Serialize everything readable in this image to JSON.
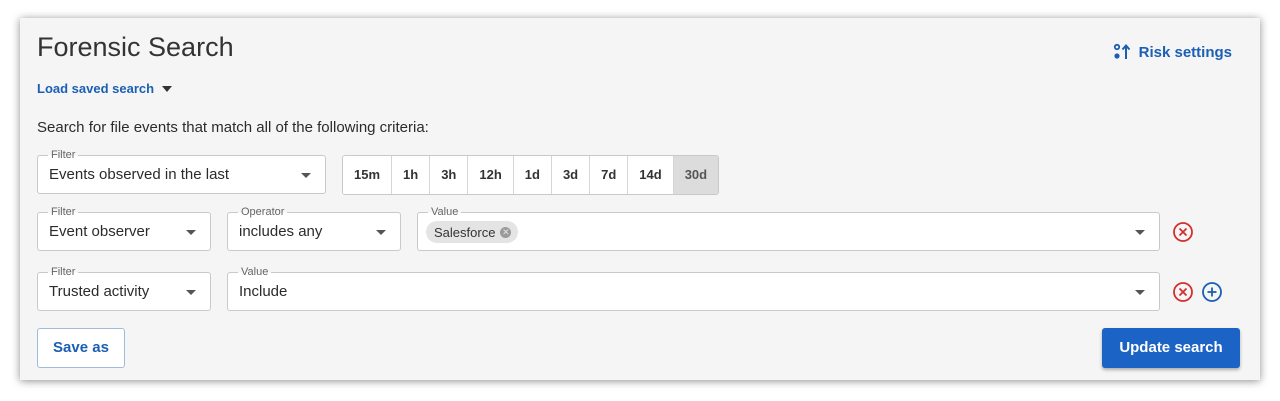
{
  "header": {
    "title": "Forensic Search",
    "risk_settings_label": "Risk settings",
    "load_saved_label": "Load saved search"
  },
  "description": "Search for file events that match all of the following criteria:",
  "row1": {
    "filter_label": "Filter",
    "filter_value": "Events observed in the last",
    "ranges": [
      "15m",
      "1h",
      "3h",
      "12h",
      "1d",
      "3d",
      "7d",
      "14d",
      "30d"
    ],
    "selected_range": "30d"
  },
  "row2": {
    "filter_label": "Filter",
    "filter_value": "Event observer",
    "operator_label": "Operator",
    "operator_value": "includes any",
    "value_label": "Value",
    "chips": [
      "Salesforce"
    ]
  },
  "row3": {
    "filter_label": "Filter",
    "filter_value": "Trusted activity",
    "value_label": "Value",
    "value_value": "Include"
  },
  "actions": {
    "save_as_label": "Save as",
    "update_label": "Update search"
  },
  "colors": {
    "accent": "#1b5fb5",
    "remove_red": "#d32f2f",
    "panel_bg": "#f5f5f5"
  },
  "icons": {
    "risk": "sliders-sort-icon",
    "remove": "circle-x-icon",
    "add": "circle-plus-icon"
  }
}
